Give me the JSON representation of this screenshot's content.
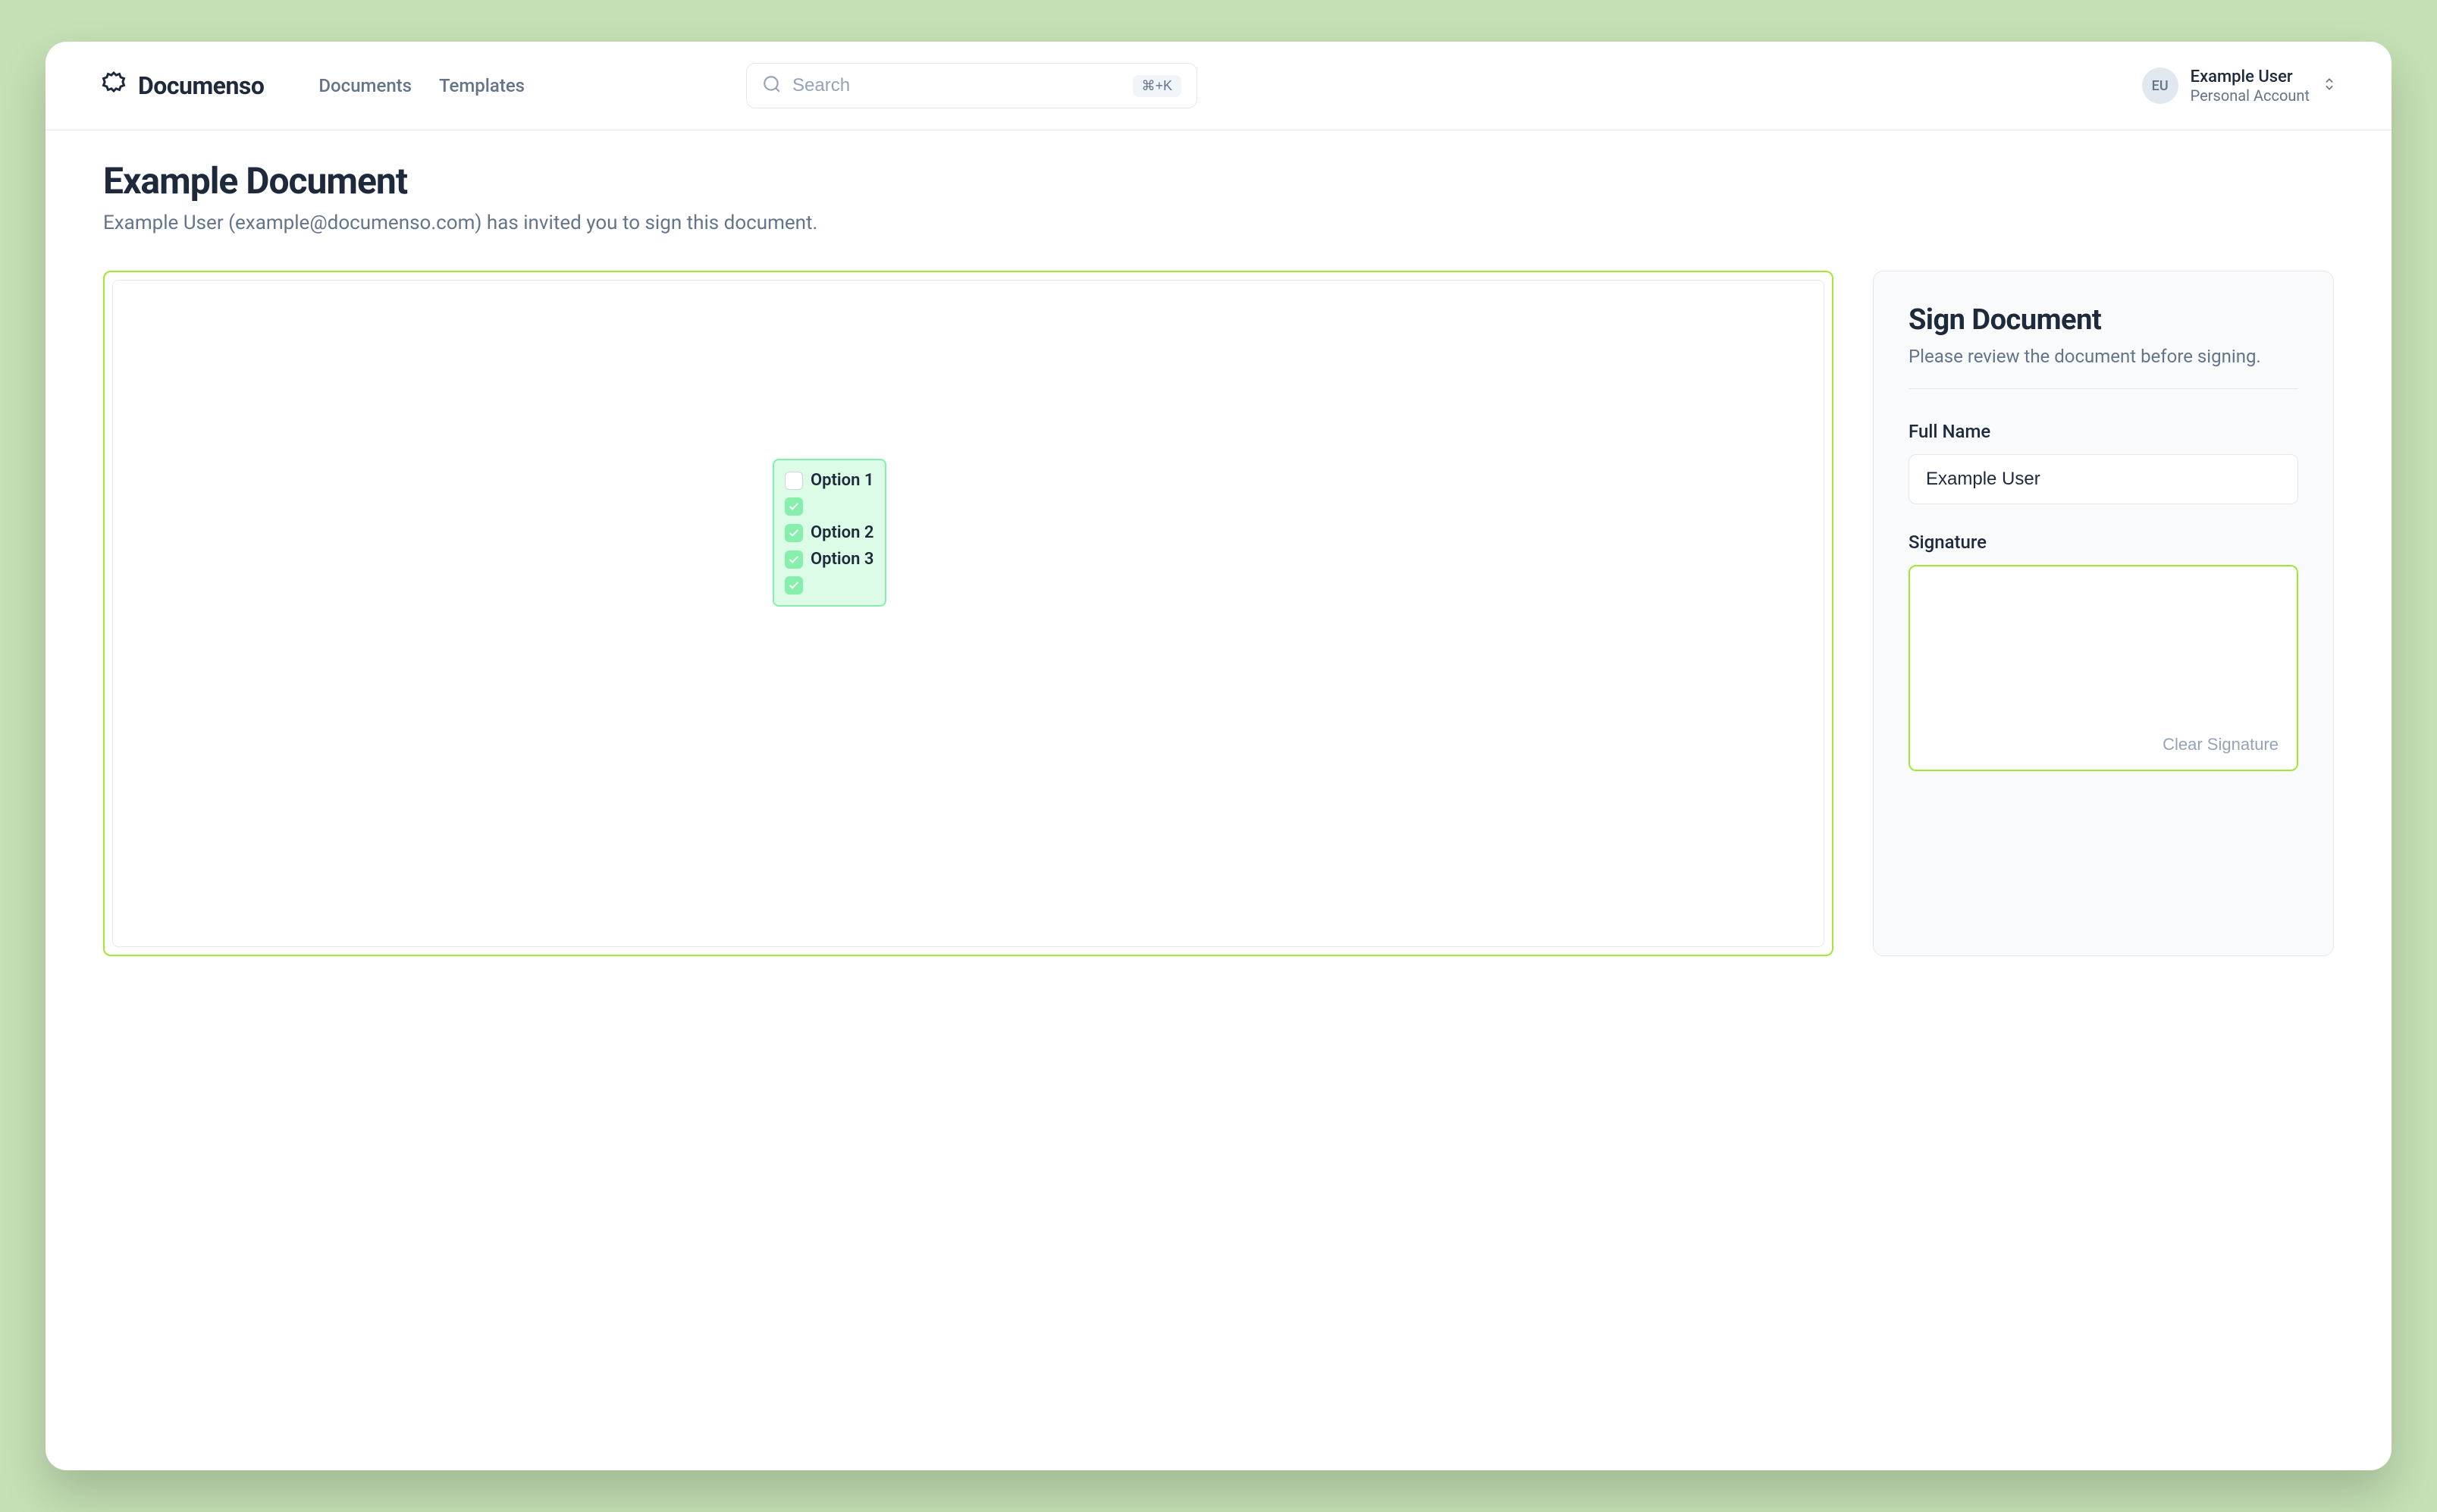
{
  "brand": "Documenso",
  "nav": {
    "documents": "Documents",
    "templates": "Templates"
  },
  "search": {
    "placeholder": "Search",
    "shortcut": "⌘+K"
  },
  "user": {
    "initials": "EU",
    "name": "Example User",
    "sub": "Personal Account"
  },
  "page": {
    "title": "Example Document",
    "subtitle": "Example User (example@documenso.com) has invited you to sign this document."
  },
  "checkbox_field": {
    "options": [
      {
        "label": "Option 1",
        "checked": false
      },
      {
        "label": "",
        "checked": true
      },
      {
        "label": "Option 2",
        "checked": true
      },
      {
        "label": "Option 3",
        "checked": true
      },
      {
        "label": "",
        "checked": true
      }
    ]
  },
  "sign_panel": {
    "title": "Sign Document",
    "subtitle": "Please review the document before signing.",
    "full_name_label": "Full Name",
    "full_name_value": "Example User",
    "signature_label": "Signature",
    "clear_signature": "Clear Signature"
  }
}
